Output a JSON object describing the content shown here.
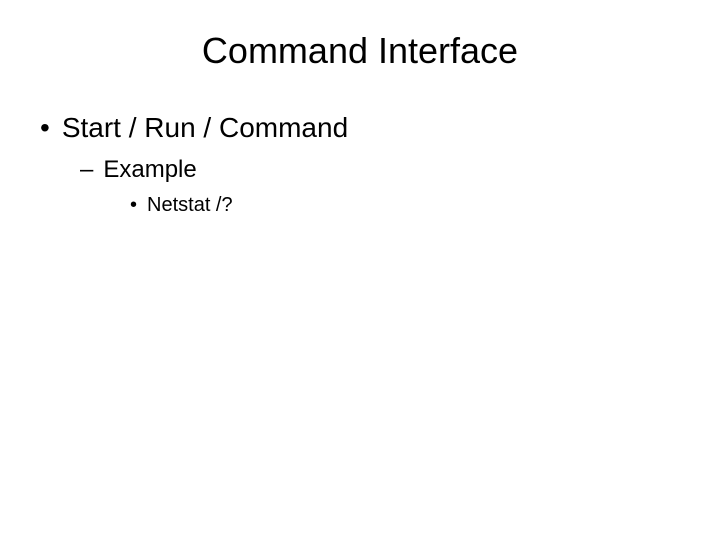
{
  "slide": {
    "title": "Command Interface",
    "bullets": {
      "level1": "Start / Run / Command",
      "level2": "Example",
      "level3": "Netstat /?"
    }
  }
}
